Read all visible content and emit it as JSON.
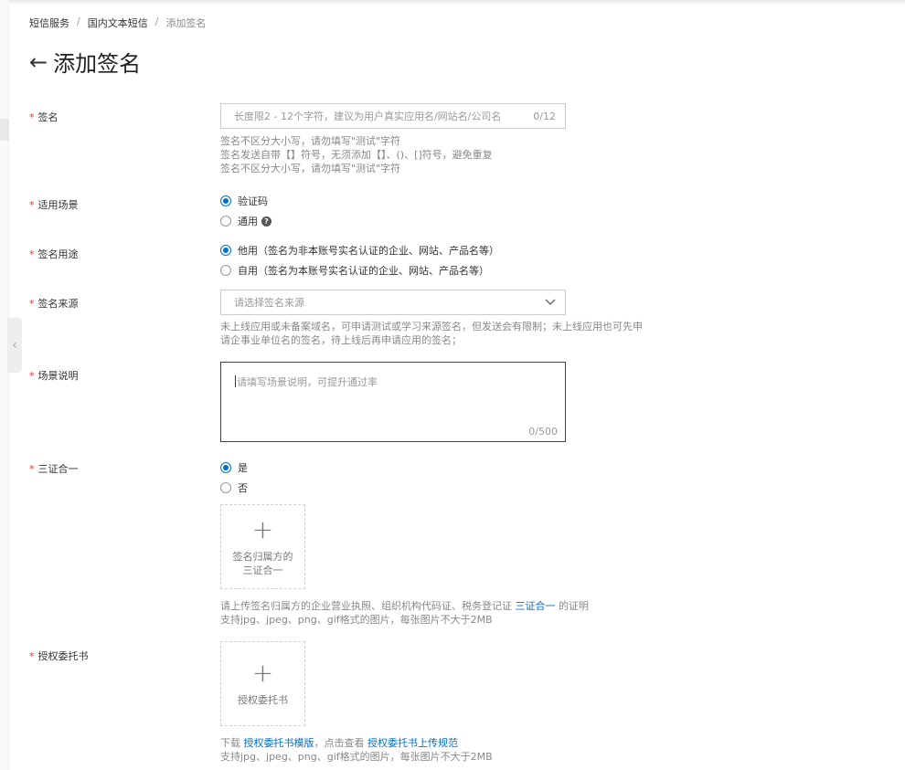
{
  "breadcrumb": {
    "item1": "短信服务",
    "item2": "国内文本短信",
    "current": "添加签名",
    "sep": "/"
  },
  "page": {
    "title": "添加签名",
    "back_icon": "←"
  },
  "required_mark": "*",
  "signature": {
    "label": "签名",
    "placeholder": "长度限2 - 12个字符，建议为用户真实应用名/网站名/公司名",
    "count": "0/12",
    "help1": "签名不区分大小写，请勿填写\"测试\"字符",
    "help2": "签名发送自带【】符号，无须添加【】、()、[]符号，避免重复",
    "help3": "签名不区分大小写，请勿填写\"测试\"字符"
  },
  "scenario": {
    "label": "适用场景",
    "option1": "验证码",
    "option2": "通用",
    "selected": "验证码"
  },
  "usage": {
    "label": "签名用途",
    "option1": "他用（签名为非本账号实名认证的企业、网站、产品名等）",
    "option2": "自用（签名为本账号实名认证的企业、网站、产品名等）",
    "selected": "他用"
  },
  "source": {
    "label": "签名来源",
    "placeholder": "请选择签名来源",
    "help1": "未上线应用或未备案域名，可申请测试或学习来源签名，但发送会有限制；未上线应用也可先申",
    "help2": "请企事业单位名的签名，待上线后再申请应用的签名；"
  },
  "description": {
    "label": "场景说明",
    "placeholder": "请填写场景说明，可提升通过率",
    "count": "0/500"
  },
  "three_in_one": {
    "label": "三证合一",
    "option1": "是",
    "option2": "否",
    "selected": "是",
    "upload_line1": "签名归属方的",
    "upload_line2": "三证合一",
    "help_prefix": "请上传签名归属方的企业营业执照、组织机构代码证、税务登记证",
    "help_link": "三证合一",
    "help_suffix": "的证明",
    "help_formats": "支持jpg、jpeg、png、gif格式的图片，每张图片不大于2MB"
  },
  "authorization": {
    "label": "授权委托书",
    "upload_text": "授权委托书",
    "help_download": "下载",
    "help_link1": "授权委托书模版",
    "help_mid": "，点击查看",
    "help_link2": "授权委托书上传规范",
    "help_formats": "支持jpg、jpeg、png、gif格式的图片，每张图片不大于2MB"
  },
  "icons": {
    "plus": "+",
    "chevron": "⌵",
    "collapse": "‹",
    "question": "?"
  },
  "colors": {
    "accent": "#0070cc",
    "required": "#e4393c"
  }
}
